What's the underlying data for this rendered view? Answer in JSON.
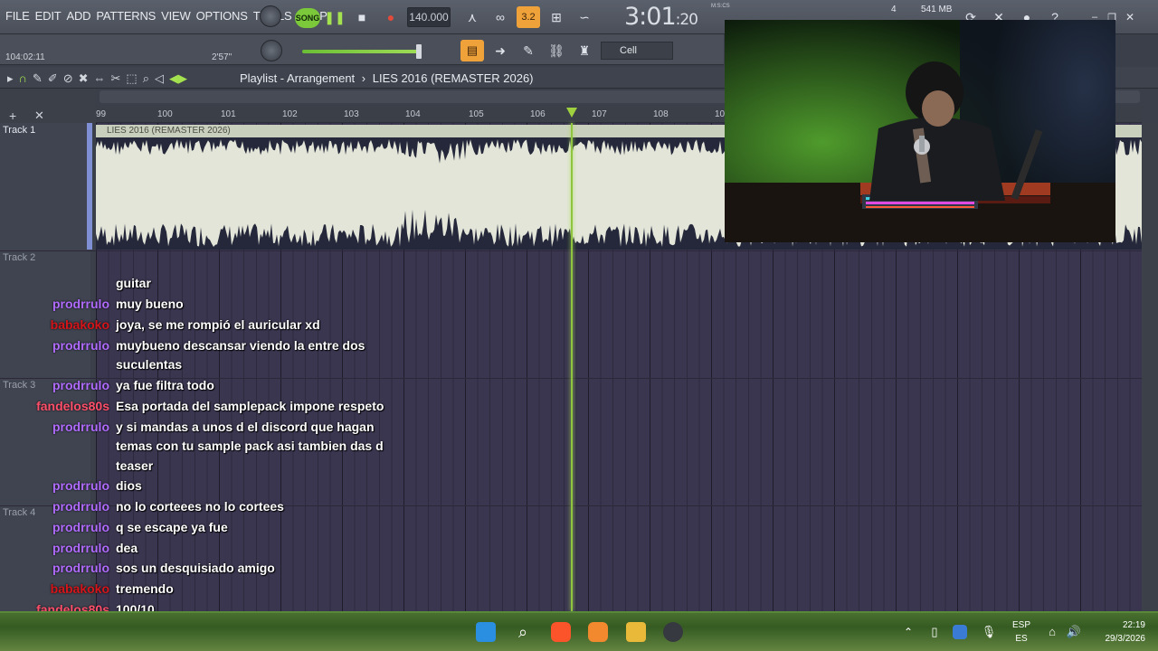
{
  "menu": [
    "FILE",
    "EDIT",
    "ADD",
    "PATTERNS",
    "VIEW",
    "OPTIONS",
    "TOOLS",
    "HELP"
  ],
  "transport": {
    "song_label": "SONG",
    "tempo": "140.000",
    "time": "3:01",
    "time_small": ":20",
    "time_mode": "M:S:CS",
    "cpu": "4",
    "memory": "541 MB",
    "snap": "Cell"
  },
  "hint": {
    "position": "104:02:11",
    "length": "2'57\""
  },
  "playlist": {
    "title": "Playlist - Arrangement",
    "separator": "›",
    "arrangement": "LIES 2016 (REMASTER 2026)",
    "ruler": [
      "99",
      "100",
      "101",
      "102",
      "103",
      "104",
      "105",
      "106",
      "107",
      "108",
      "10"
    ],
    "tracks": [
      "Track 1",
      "Track 2",
      "Track 3",
      "Track 4"
    ],
    "clip_name": "LIES 2016 (REMASTER 2026)"
  },
  "chat": [
    {
      "user": "",
      "text": "guitar",
      "color": "#b06bff"
    },
    {
      "user": "prodrrulo",
      "text": "muy bueno",
      "color": "#b06bff"
    },
    {
      "user": "babakoko",
      "text": "joya, se me rompió el auricular xd",
      "color": "#d4161b"
    },
    {
      "user": "prodrrulo",
      "text": "muybueno descansar viendo la entre dos",
      "color": "#b06bff"
    },
    {
      "user": "",
      "text": "suculentas",
      "color": "#b06bff"
    },
    {
      "user": "prodrrulo",
      "text": "ya fue filtra todo",
      "color": "#b06bff"
    },
    {
      "user": "fandelos80s",
      "text": "Esa portada del samplepack impone respeto",
      "color": "#ff4f6a"
    },
    {
      "user": "prodrrulo",
      "text": "y si mandas a unos d el discord que hagan",
      "color": "#b06bff"
    },
    {
      "user": "",
      "text": "temas con tu sample pack asi tambien das d",
      "color": "#b06bff"
    },
    {
      "user": "",
      "text": "teaser",
      "color": "#b06bff"
    },
    {
      "user": "prodrrulo",
      "text": "dios",
      "color": "#b06bff"
    },
    {
      "user": "prodrrulo",
      "text": "no lo corteees no lo cortees",
      "color": "#b06bff"
    },
    {
      "user": "prodrrulo",
      "text": "q se escape ya fue",
      "color": "#b06bff"
    },
    {
      "user": "prodrrulo",
      "text": "dea",
      "color": "#b06bff"
    },
    {
      "user": "prodrrulo",
      "text": "sos un desquisiado amigo",
      "color": "#b06bff"
    },
    {
      "user": "babakoko",
      "text": "tremendo",
      "color": "#d4161b"
    },
    {
      "user": "fandelos80s",
      "text": "100/10",
      "color": "#ff4f6a"
    }
  ],
  "tray": {
    "lang_top": "ESP",
    "lang_bottom": "ES",
    "time": "22:19",
    "date": "29/3/2026"
  },
  "colors": {
    "accent": "#8ec43e",
    "clip": "#e2e5d8",
    "grid": "#3b3650"
  }
}
